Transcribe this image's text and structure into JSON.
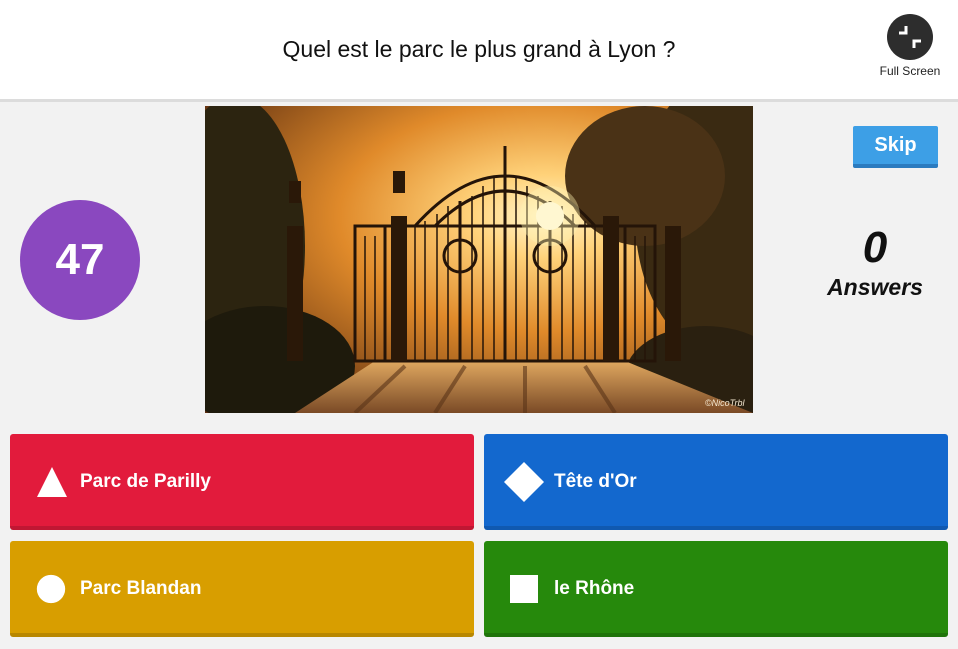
{
  "header": {
    "question": "Quel est le parc le plus grand à Lyon ?",
    "fullscreen_label": "Full Screen",
    "fullscreen_icon": "fullscreen-icon"
  },
  "timer": {
    "value": "47",
    "color": "#8a48bf"
  },
  "media": {
    "watermark": "©NicoTrbl"
  },
  "skip": {
    "label": "Skip"
  },
  "answers_counter": {
    "count": "0",
    "label": "Answers"
  },
  "answers": [
    {
      "label": "Parc de Parilly",
      "shape": "triangle-icon",
      "color": "#e21b3c"
    },
    {
      "label": "Tête d'Or",
      "shape": "diamond-icon",
      "color": "#1368ce"
    },
    {
      "label": "Parc Blandan",
      "shape": "circle-icon",
      "color": "#d89e00"
    },
    {
      "label": "le Rhône",
      "shape": "square-icon",
      "color": "#26890c"
    }
  ]
}
